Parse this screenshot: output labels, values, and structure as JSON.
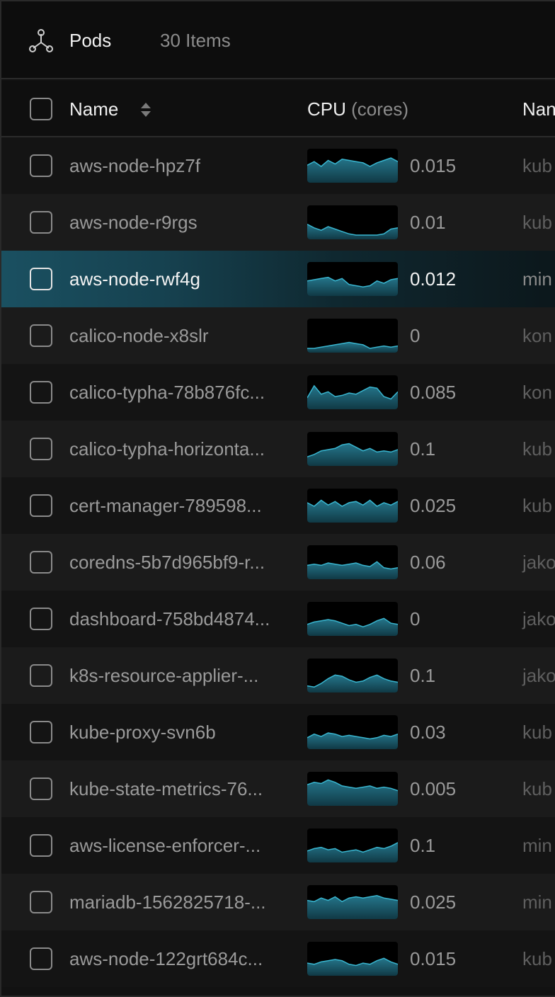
{
  "header": {
    "title": "Pods",
    "count": "30 Items"
  },
  "columns": {
    "name": "Name",
    "cpu": "CPU",
    "cpu_unit": "(cores)",
    "namespace": "Nan"
  },
  "colors": {
    "accent": "#39b6d0",
    "selected_row": "#1a5061"
  },
  "rows": [
    {
      "name": "aws-node-hpz7f",
      "cpu": "0.015",
      "namespace": "kub",
      "selected": false,
      "spark": [
        0.55,
        0.7,
        0.5,
        0.75,
        0.6,
        0.8,
        0.75,
        0.7,
        0.65,
        0.5,
        0.65,
        0.75,
        0.85,
        0.7
      ]
    },
    {
      "name": "aws-node-r9rgs",
      "cpu": "0.01",
      "namespace": "kub",
      "selected": false,
      "spark": [
        0.45,
        0.3,
        0.2,
        0.35,
        0.25,
        0.15,
        0.05,
        0.0,
        0.0,
        0.0,
        0.0,
        0.05,
        0.25,
        0.3
      ]
    },
    {
      "name": "aws-node-rwf4g",
      "cpu": "0.012",
      "namespace": "min",
      "selected": true,
      "spark": [
        0.45,
        0.5,
        0.55,
        0.6,
        0.45,
        0.55,
        0.3,
        0.25,
        0.2,
        0.25,
        0.45,
        0.35,
        0.5,
        0.55
      ]
    },
    {
      "name": "calico-node-x8slr",
      "cpu": "0",
      "namespace": "kon",
      "selected": false,
      "spark": [
        0.0,
        0.0,
        0.05,
        0.1,
        0.15,
        0.2,
        0.25,
        0.2,
        0.15,
        0.0,
        0.05,
        0.1,
        0.05,
        0.1
      ]
    },
    {
      "name": "calico-typha-78b876fc...",
      "cpu": "0.085",
      "namespace": "kon",
      "selected": false,
      "spark": [
        0.3,
        0.8,
        0.45,
        0.55,
        0.35,
        0.4,
        0.5,
        0.45,
        0.6,
        0.75,
        0.7,
        0.35,
        0.25,
        0.55
      ]
    },
    {
      "name": "calico-typha-horizonta...",
      "cpu": "0.1",
      "namespace": "kub",
      "selected": false,
      "spark": [
        0.2,
        0.3,
        0.45,
        0.5,
        0.55,
        0.7,
        0.75,
        0.6,
        0.45,
        0.55,
        0.4,
        0.45,
        0.4,
        0.5
      ]
    },
    {
      "name": "cert-manager-789598...",
      "cpu": "0.025",
      "namespace": "kub",
      "selected": false,
      "spark": [
        0.65,
        0.5,
        0.75,
        0.55,
        0.7,
        0.5,
        0.65,
        0.7,
        0.55,
        0.75,
        0.5,
        0.65,
        0.55,
        0.7
      ]
    },
    {
      "name": "coredns-5b7d965bf9-r...",
      "cpu": "0.06",
      "namespace": "jako",
      "selected": false,
      "spark": [
        0.4,
        0.45,
        0.4,
        0.5,
        0.45,
        0.4,
        0.45,
        0.5,
        0.4,
        0.35,
        0.55,
        0.3,
        0.25,
        0.3
      ]
    },
    {
      "name": "dashboard-758bd4874...",
      "cpu": "0",
      "namespace": "jako",
      "selected": false,
      "spark": [
        0.3,
        0.4,
        0.45,
        0.5,
        0.45,
        0.35,
        0.25,
        0.3,
        0.2,
        0.3,
        0.45,
        0.55,
        0.35,
        0.3
      ]
    },
    {
      "name": "k8s-resource-applier-...",
      "cpu": "0.1",
      "namespace": "jako",
      "selected": false,
      "spark": [
        0.1,
        0.05,
        0.2,
        0.4,
        0.55,
        0.5,
        0.35,
        0.25,
        0.3,
        0.45,
        0.55,
        0.4,
        0.3,
        0.25
      ]
    },
    {
      "name": "kube-proxy-svn6b",
      "cpu": "0.03",
      "namespace": "kub",
      "selected": false,
      "spark": [
        0.3,
        0.45,
        0.35,
        0.5,
        0.45,
        0.35,
        0.4,
        0.35,
        0.3,
        0.25,
        0.3,
        0.4,
        0.35,
        0.45
      ]
    },
    {
      "name": "kube-state-metrics-76...",
      "cpu": "0.005",
      "namespace": "kub",
      "selected": false,
      "spark": [
        0.7,
        0.8,
        0.75,
        0.9,
        0.8,
        0.65,
        0.6,
        0.55,
        0.6,
        0.65,
        0.55,
        0.6,
        0.55,
        0.45
      ]
    },
    {
      "name": "aws-license-enforcer-...",
      "cpu": "0.1",
      "namespace": "min",
      "selected": false,
      "spark": [
        0.3,
        0.4,
        0.45,
        0.35,
        0.4,
        0.25,
        0.3,
        0.35,
        0.25,
        0.35,
        0.45,
        0.4,
        0.5,
        0.65
      ]
    },
    {
      "name": "mariadb-1562825718-...",
      "cpu": "0.025",
      "namespace": "min",
      "selected": false,
      "spark": [
        0.6,
        0.55,
        0.7,
        0.6,
        0.75,
        0.55,
        0.7,
        0.75,
        0.7,
        0.75,
        0.8,
        0.7,
        0.65,
        0.6
      ]
    },
    {
      "name": "aws-node-122grt684c...",
      "cpu": "0.015",
      "namespace": "kub",
      "selected": false,
      "spark": [
        0.35,
        0.3,
        0.4,
        0.45,
        0.5,
        0.45,
        0.3,
        0.25,
        0.35,
        0.3,
        0.45,
        0.55,
        0.4,
        0.3
      ]
    }
  ]
}
